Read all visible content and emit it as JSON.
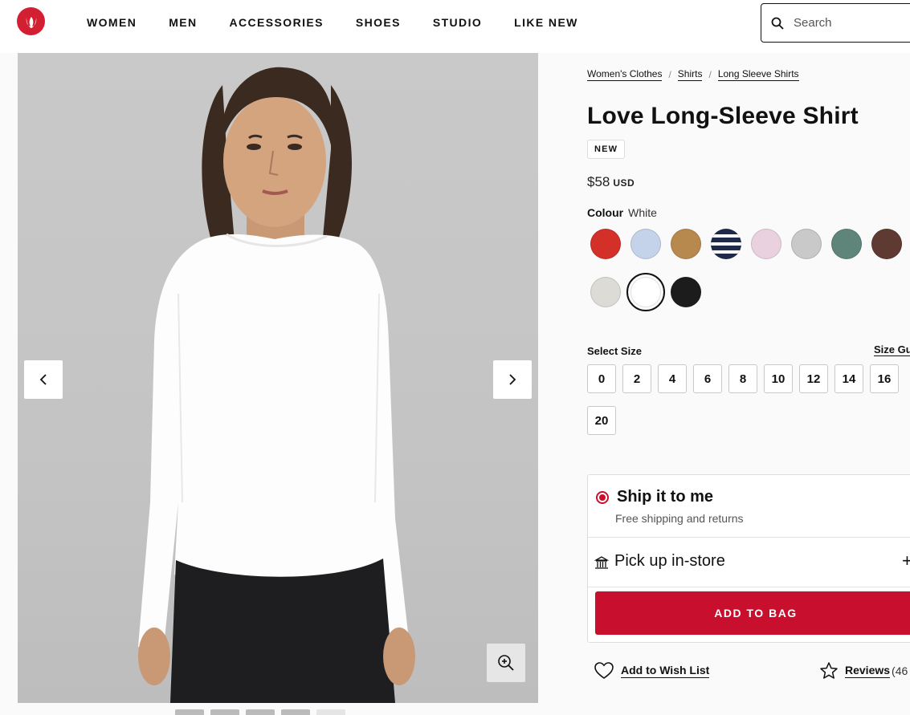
{
  "header": {
    "logo_alt": "lululemon",
    "nav": [
      "WOMEN",
      "MEN",
      "ACCESSORIES",
      "SHOES",
      "STUDIO",
      "LIKE NEW"
    ],
    "search_placeholder": "Search"
  },
  "breadcrumb": [
    "Women's Clothes",
    "Shirts",
    "Long Sleeve Shirts"
  ],
  "product": {
    "title": "Love Long-Sleeve Shirt",
    "badge": "NEW",
    "price": "$58",
    "currency": "USD"
  },
  "colour": {
    "label": "Colour",
    "selected": "White",
    "swatches": [
      {
        "name": "red",
        "color": "#d3302a"
      },
      {
        "name": "light-blue",
        "color": "#c4d2ea"
      },
      {
        "name": "tan",
        "color": "#b7894f"
      },
      {
        "name": "navy-stripe",
        "color": "#1f2a4a"
      },
      {
        "name": "pink",
        "color": "#ead1df"
      },
      {
        "name": "heather-grey",
        "color": "#c9c9c9"
      },
      {
        "name": "green-grey",
        "color": "#5f857b"
      },
      {
        "name": "brown",
        "color": "#5e3a32"
      },
      {
        "name": "bone",
        "color": "#dddbd6"
      },
      {
        "name": "white",
        "color": "#ffffff"
      },
      {
        "name": "black",
        "color": "#1c1c1c"
      }
    ]
  },
  "size": {
    "label": "Select Size",
    "guide_label": "Size Gu",
    "options": [
      "0",
      "2",
      "4",
      "6",
      "8",
      "10",
      "12",
      "14",
      "16",
      "20"
    ]
  },
  "shipping": {
    "ship_title": "Ship it to me",
    "ship_sub": "Free shipping and returns",
    "pickup_title": "Pick up in-store",
    "expand_symbol": "+",
    "add_to_bag": "ADD TO BAG"
  },
  "actions": {
    "wishlist": "Add to Wish List",
    "reviews": "Reviews",
    "reviews_count": "(46"
  },
  "colors": {
    "brand_red": "#c8102e",
    "logo_red": "#d31f32"
  }
}
